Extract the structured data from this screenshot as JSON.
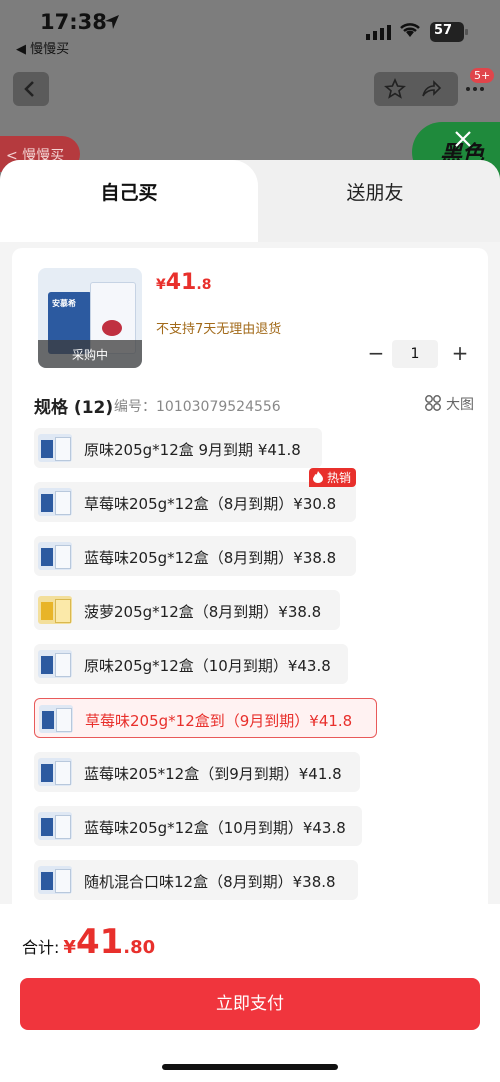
{
  "status_bar": {
    "time": "17:38",
    "back_app": "◀ 慢慢买",
    "battery": "57"
  },
  "backdrop": {
    "badge": "5+",
    "side_tag": "< 慢慢买",
    "green_tag": "黑色"
  },
  "tabs": {
    "self": "自己买",
    "friend": "送朋友"
  },
  "product": {
    "price_symbol": "¥",
    "price_int": "41",
    "price_dec": ".8",
    "return_note": "不支持7天无理由退货",
    "status_overlay": "采购中",
    "quantity": "1",
    "brand_on_box": "安慕希"
  },
  "spec": {
    "title": "规格 (12)",
    "code": "编号：10103079524556",
    "big_view": "大图"
  },
  "options": [
    {
      "label": "原味205g*12盒 9月到期  ¥41.8"
    },
    {
      "label": "草莓味205g*12盒（8月到期）¥30.8",
      "badge": "热销"
    },
    {
      "label": "蓝莓味205g*12盒（8月到期）¥38.8"
    },
    {
      "label": "菠萝205g*12盒（8月到期）¥38.8"
    },
    {
      "label": "原味205g*12盒（10月到期）¥43.8"
    },
    {
      "label": "草莓味205g*12盒到（9月到期）¥41.8"
    },
    {
      "label": "蓝莓味205*12盒（到9月到期）¥41.8"
    },
    {
      "label": "蓝莓味205g*12盒（10月到期）¥43.8"
    },
    {
      "label": "随机混合口味12盒（8月到期）¥38.8"
    }
  ],
  "footer": {
    "total_label": "合计:",
    "total_symbol": "¥",
    "total_int": "41",
    "total_dec": ".80",
    "pay_label": "立即支付"
  },
  "colors": {
    "accent": "#e8302c",
    "pay_button": "#f0353d",
    "return_note": "#a26a1a"
  }
}
